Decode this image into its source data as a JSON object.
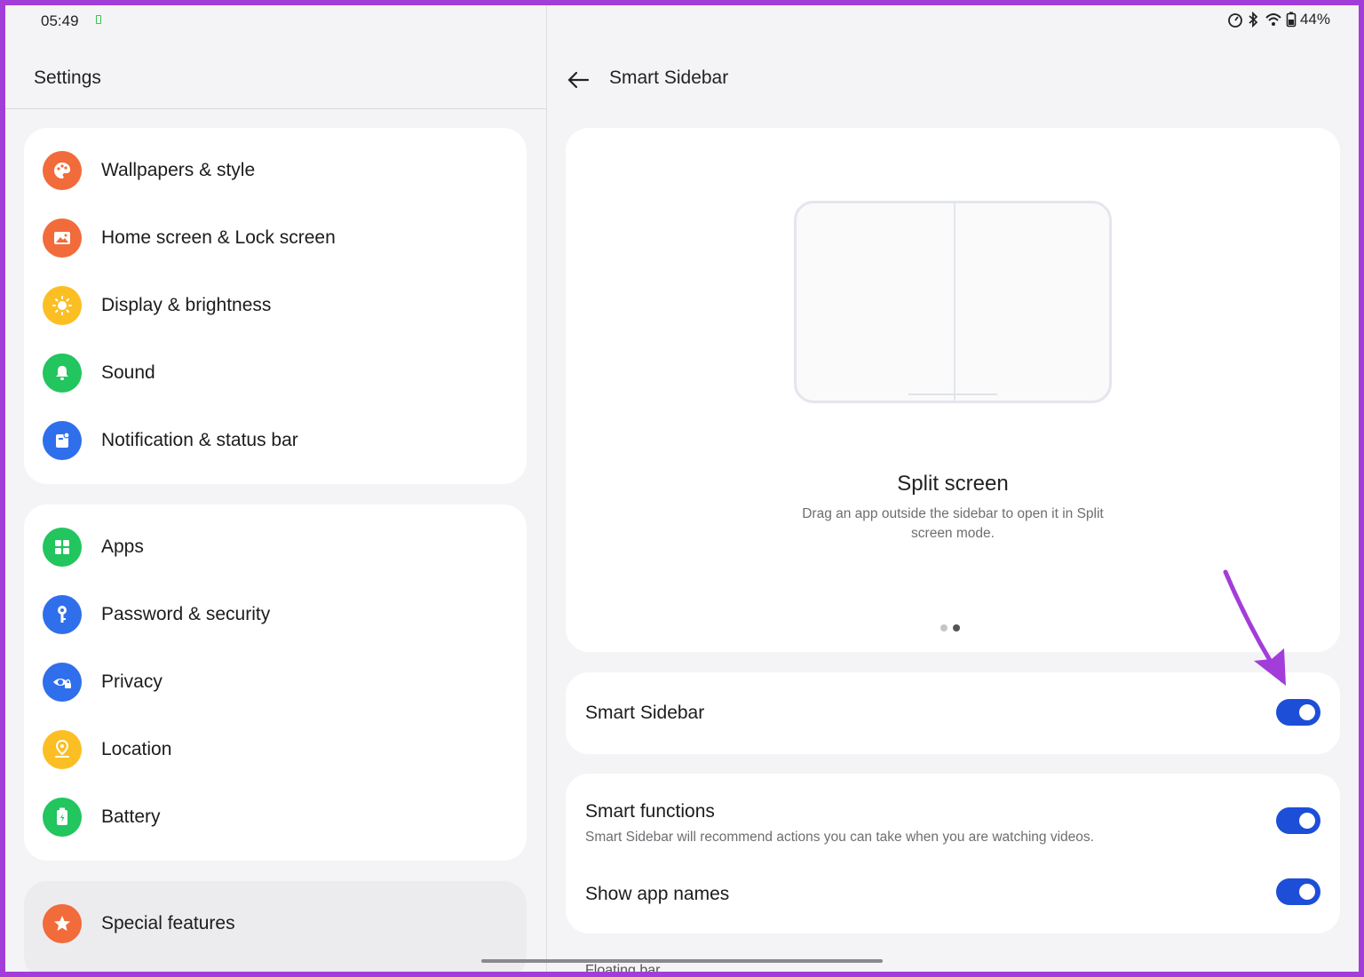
{
  "status_bar": {
    "time": "05:49",
    "battery": "44%"
  },
  "left_panel": {
    "title": "Settings",
    "group1": [
      {
        "label": "Wallpapers & style",
        "icon": "palette-icon",
        "color": "#f26b3a"
      },
      {
        "label": "Home screen & Lock screen",
        "icon": "image-icon",
        "color": "#f26b3a"
      },
      {
        "label": "Display & brightness",
        "icon": "sun-icon",
        "color": "#fbbf24"
      },
      {
        "label": "Sound",
        "icon": "bell-icon",
        "color": "#22c55e"
      },
      {
        "label": "Notification & status bar",
        "icon": "notification-icon",
        "color": "#2f6fec"
      }
    ],
    "group2": [
      {
        "label": "Apps",
        "icon": "apps-grid-icon",
        "color": "#22c55e"
      },
      {
        "label": "Password & security",
        "icon": "key-icon",
        "color": "#2f6fec"
      },
      {
        "label": "Privacy",
        "icon": "eye-lock-icon",
        "color": "#2f6fec"
      },
      {
        "label": "Location",
        "icon": "location-pin-icon",
        "color": "#fbbf24"
      },
      {
        "label": "Battery",
        "icon": "battery-icon",
        "color": "#22c55e"
      }
    ],
    "group3": [
      {
        "label": "Special features",
        "icon": "star-icon",
        "color": "#f26b3a"
      }
    ]
  },
  "right_panel": {
    "title": "Smart Sidebar",
    "preview": {
      "title": "Split screen",
      "description": "Drag an app outside the sidebar to open it in Split screen mode."
    },
    "smart_sidebar": {
      "label": "Smart Sidebar",
      "on": true
    },
    "smart_functions": {
      "label": "Smart functions",
      "sublabel": "Smart Sidebar will recommend actions you can take when you are watching videos.",
      "on": true
    },
    "show_app_names": {
      "label": "Show app names",
      "on": true
    },
    "peek_label": "Floating bar"
  },
  "colors": {
    "accent": "#1d4ed8",
    "annotation_arrow": "#a33dd9"
  }
}
